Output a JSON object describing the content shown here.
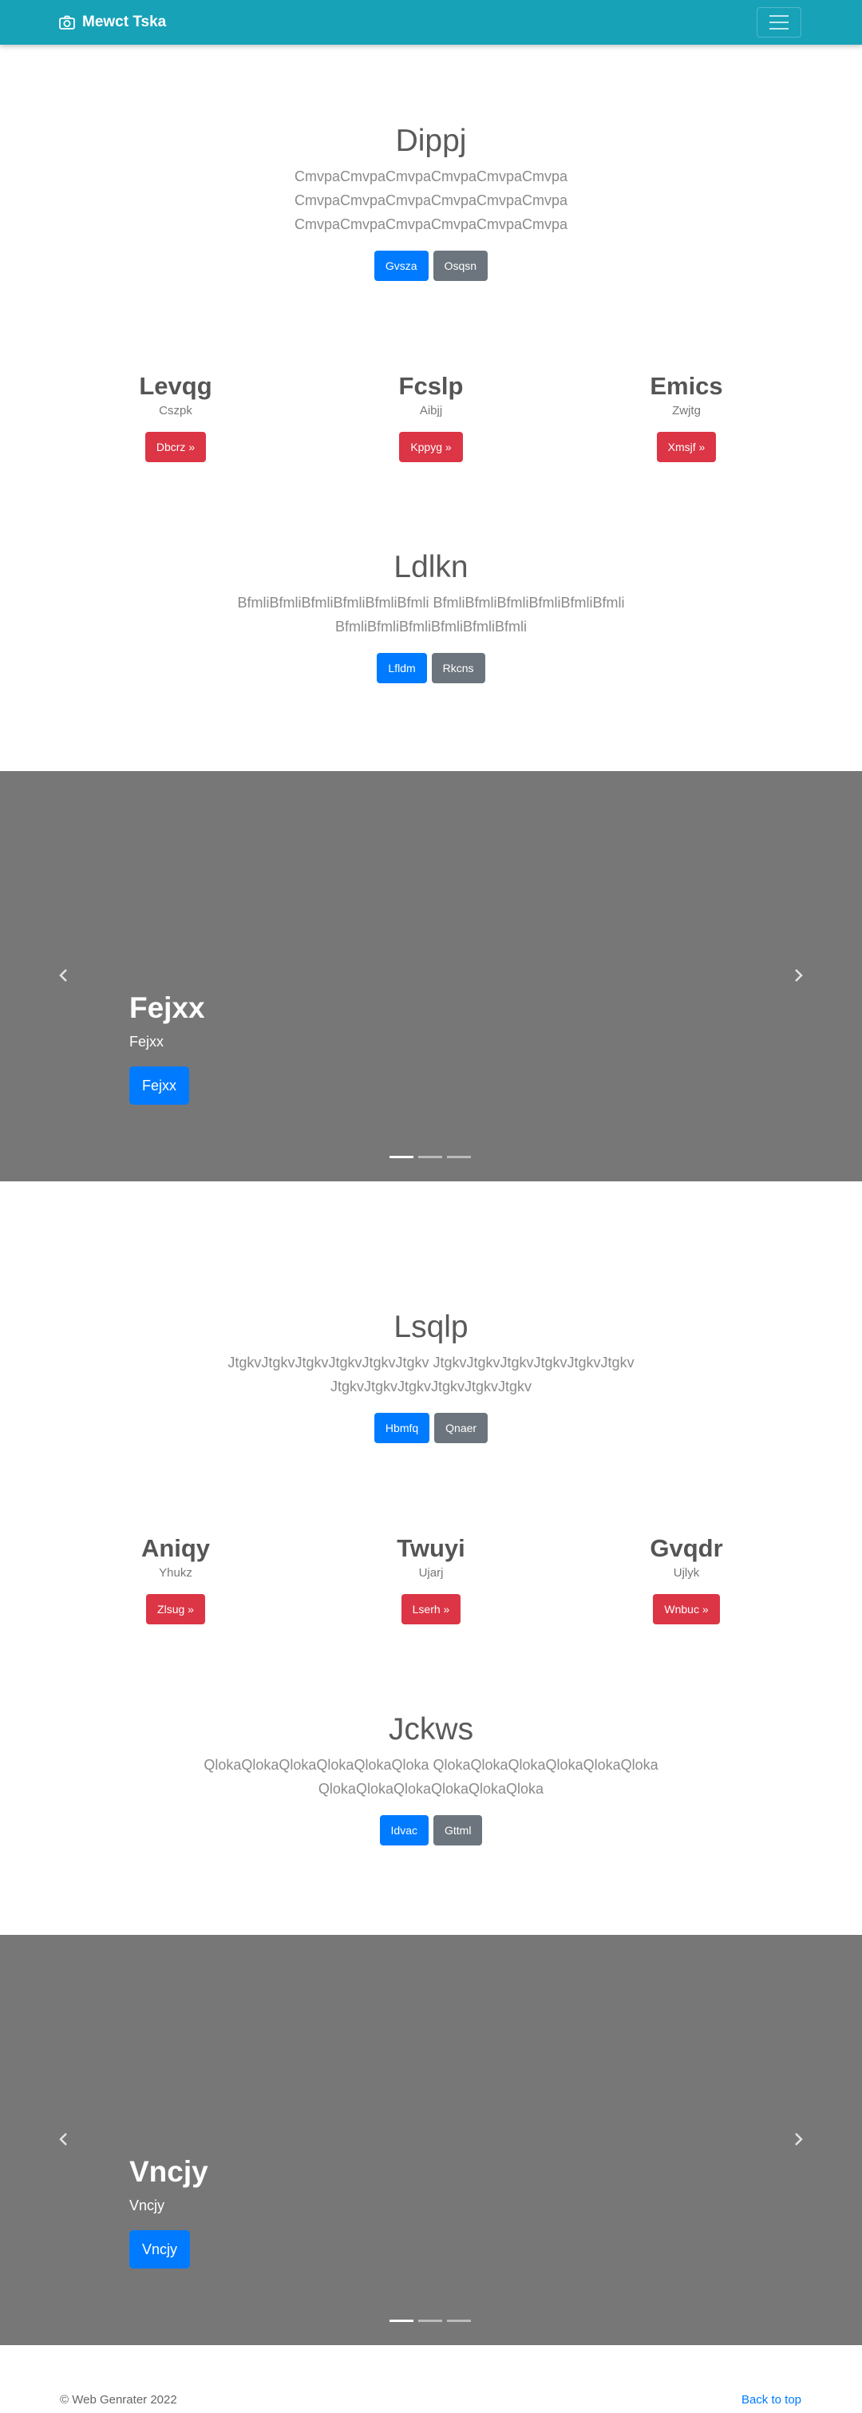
{
  "navbar": {
    "brand": "Mewct Tska",
    "brand_icon": "camera-icon",
    "toggler_icon": "hamburger-icon"
  },
  "jumbo1": {
    "title": "Dippj",
    "lead_lines": [
      "CmvpaCmvpaCmvpaCmvpaCmvpaCmvpa",
      "CmvpaCmvpaCmvpaCmvpaCmvpaCmvpa",
      "CmvpaCmvpaCmvpaCmvpaCmvpaCmvpa"
    ],
    "btn_primary": "Gvsza",
    "btn_secondary": "Osqsn"
  },
  "cols1": [
    {
      "title": "Levqg",
      "text": "Cszpk",
      "button": "Dbcrz »"
    },
    {
      "title": "Fcslp",
      "text": "Aibjj",
      "button": "Kppyg »"
    },
    {
      "title": "Emics",
      "text": "Zwjtg",
      "button": "Xmsjf »"
    }
  ],
  "jumbo2": {
    "title": "Ldlkn",
    "lead_lines": [
      "BfmliBfmliBfmliBfmliBfmliBfmli BfmliBfmliBfmliBfmliBfmliBfmli",
      "BfmliBfmliBfmliBfmliBfmliBfmli"
    ],
    "btn_primary": "Lfldm",
    "btn_secondary": "Rkcns"
  },
  "carousel1": {
    "title": "Fejxx",
    "text": "Fejxx",
    "button": "Fejxx",
    "slides": 3,
    "active_slide": 1
  },
  "jumbo3": {
    "title": "Lsqlp",
    "lead_lines": [
      "JtgkvJtgkvJtgkvJtgkvJtgkvJtgkv JtgkvJtgkvJtgkvJtgkvJtgkvJtgkv",
      "JtgkvJtgkvJtgkvJtgkvJtgkvJtgkv"
    ],
    "btn_primary": "Hbmfq",
    "btn_secondary": "Qnaer"
  },
  "cols2": [
    {
      "title": "Aniqy",
      "text": "Yhukz",
      "button": "Zlsug »"
    },
    {
      "title": "Twuyi",
      "text": "Ujarj",
      "button": "Lserh »"
    },
    {
      "title": "Gvqdr",
      "text": "Ujlyk",
      "button": "Wnbuc »"
    }
  ],
  "jumbo4": {
    "title": "Jckws",
    "lead_lines": [
      "QlokaQlokaQlokaQlokaQlokaQloka QlokaQlokaQlokaQlokaQlokaQloka",
      "QlokaQlokaQlokaQlokaQlokaQloka"
    ],
    "btn_primary": "Idvac",
    "btn_secondary": "Gttml"
  },
  "carousel2": {
    "title": "Vncjy",
    "text": "Vncjy",
    "button": "Vncjy",
    "slides": 3,
    "active_slide": 1
  },
  "footer": {
    "copyright": "© Web Genrater 2022",
    "back_to_top": "Back to top"
  },
  "colors": {
    "navbar": "#17a2b8",
    "primary": "#007bff",
    "secondary": "#6c757d",
    "danger": "#dc3545",
    "carousel_bg": "#777777"
  }
}
